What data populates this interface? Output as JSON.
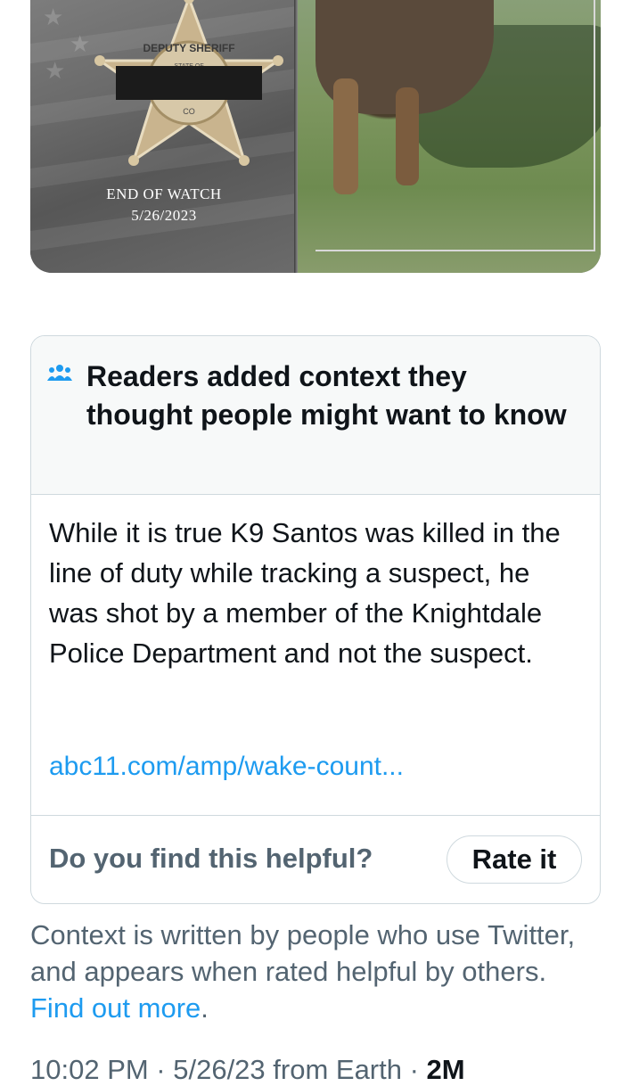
{
  "media": {
    "eow_line1": "END OF WATCH",
    "eow_line2": "5/26/2023",
    "badge_text": "DEPUTY SHERIFF",
    "badge_center": "STATE OF",
    "badge_bottom": "CO"
  },
  "note": {
    "icon": "people-group-icon",
    "title": "Readers added context they thought people might want to know",
    "body": "While it is true K9 Santos was killed in the line of duty while tracking a suspect, he was shot by a member of the Knightdale Police Department and not the suspect.",
    "link": "abc11.com/amp/wake-count...",
    "helpful_question": "Do you find this helpful?",
    "rate_button": "Rate it"
  },
  "footer": {
    "text": "Context is written by people who use Twitter, and appears when rated helpful by others.",
    "link": "Find out more",
    "period": ".",
    "meta_time": "10:02 PM · 5/26/23 from Earth · ",
    "meta_views": "2M"
  },
  "colors": {
    "accent": "#1d9bf0",
    "secondary_text": "#536471",
    "border": "#cfd9de",
    "header_bg": "#f7f9f9"
  }
}
